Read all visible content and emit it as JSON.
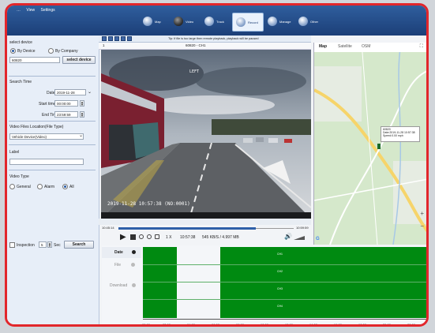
{
  "menu": {
    "items": [
      "…",
      "View",
      "Settings"
    ]
  },
  "nav": [
    {
      "label": "Map",
      "icon": "globe-icon"
    },
    {
      "label": "Video",
      "icon": "camera-icon"
    },
    {
      "label": "Track",
      "icon": "track-icon"
    },
    {
      "label": "Record",
      "icon": "record-icon",
      "active": true
    },
    {
      "label": "Manage",
      "icon": "manage-icon"
    },
    {
      "label": "Other",
      "icon": "other-icon"
    }
  ],
  "left": {
    "select_device_title": "select device",
    "by_device": "By Device",
    "by_company": "By Company",
    "device_value": "60820",
    "select_device_button": "select device",
    "search_time_title": "Search Time",
    "date_label": "Date",
    "date_value": "2019-11-28",
    "start_label": "Start time",
    "start_value": "00:00:00",
    "end_label": "End Time",
    "end_value": "23:59:59",
    "location_title": "Video Files Location(File Type)",
    "location_value": "Vehicle Device(Video)",
    "label_title": "Label",
    "label_value": "",
    "video_type_title": "Video Type",
    "type_general": "General",
    "type_alarm": "Alarm",
    "type_all": "All",
    "inspection_label": "Inspection",
    "inspection_value": "5",
    "inspection_unit": "Sec",
    "search_button": "Search"
  },
  "video": {
    "notice": "Tip: If file is too large then remote playback, playback will be paused",
    "channel": "1",
    "title": "60820 - CH1",
    "osd_label": "LEFT",
    "osd_timestamp": "2019-11-28 10:57:38 (NO:0001)"
  },
  "map": {
    "tabs": [
      "Map",
      "Satellite",
      "OSM"
    ],
    "popup_line1": "60820",
    "popup_line2": "Date:2019-11-28 10:57:38",
    "popup_line3": "Speed:0.00 mph"
  },
  "playback": {
    "time_start": "10:45:14",
    "time_end": "10:59:59",
    "speed": "1 X",
    "current_time": "10:57:38",
    "size": "545 KB/S / 4.997 MB"
  },
  "timeline": {
    "rows": [
      "Date",
      "File",
      "Download"
    ],
    "row_labels": [
      "CH1",
      "CH2",
      "CH3",
      "CH4"
    ],
    "hours": [
      "00:00",
      "02:00",
      "04:00",
      "06:00",
      "08:00",
      "10:00",
      "12:00",
      "14:00",
      "16:00",
      "18:00",
      "20:00",
      "22:00"
    ]
  },
  "colors": {
    "accent": "#1c3f78",
    "frame": "#e2262b",
    "timeline_green": "#008a11"
  }
}
